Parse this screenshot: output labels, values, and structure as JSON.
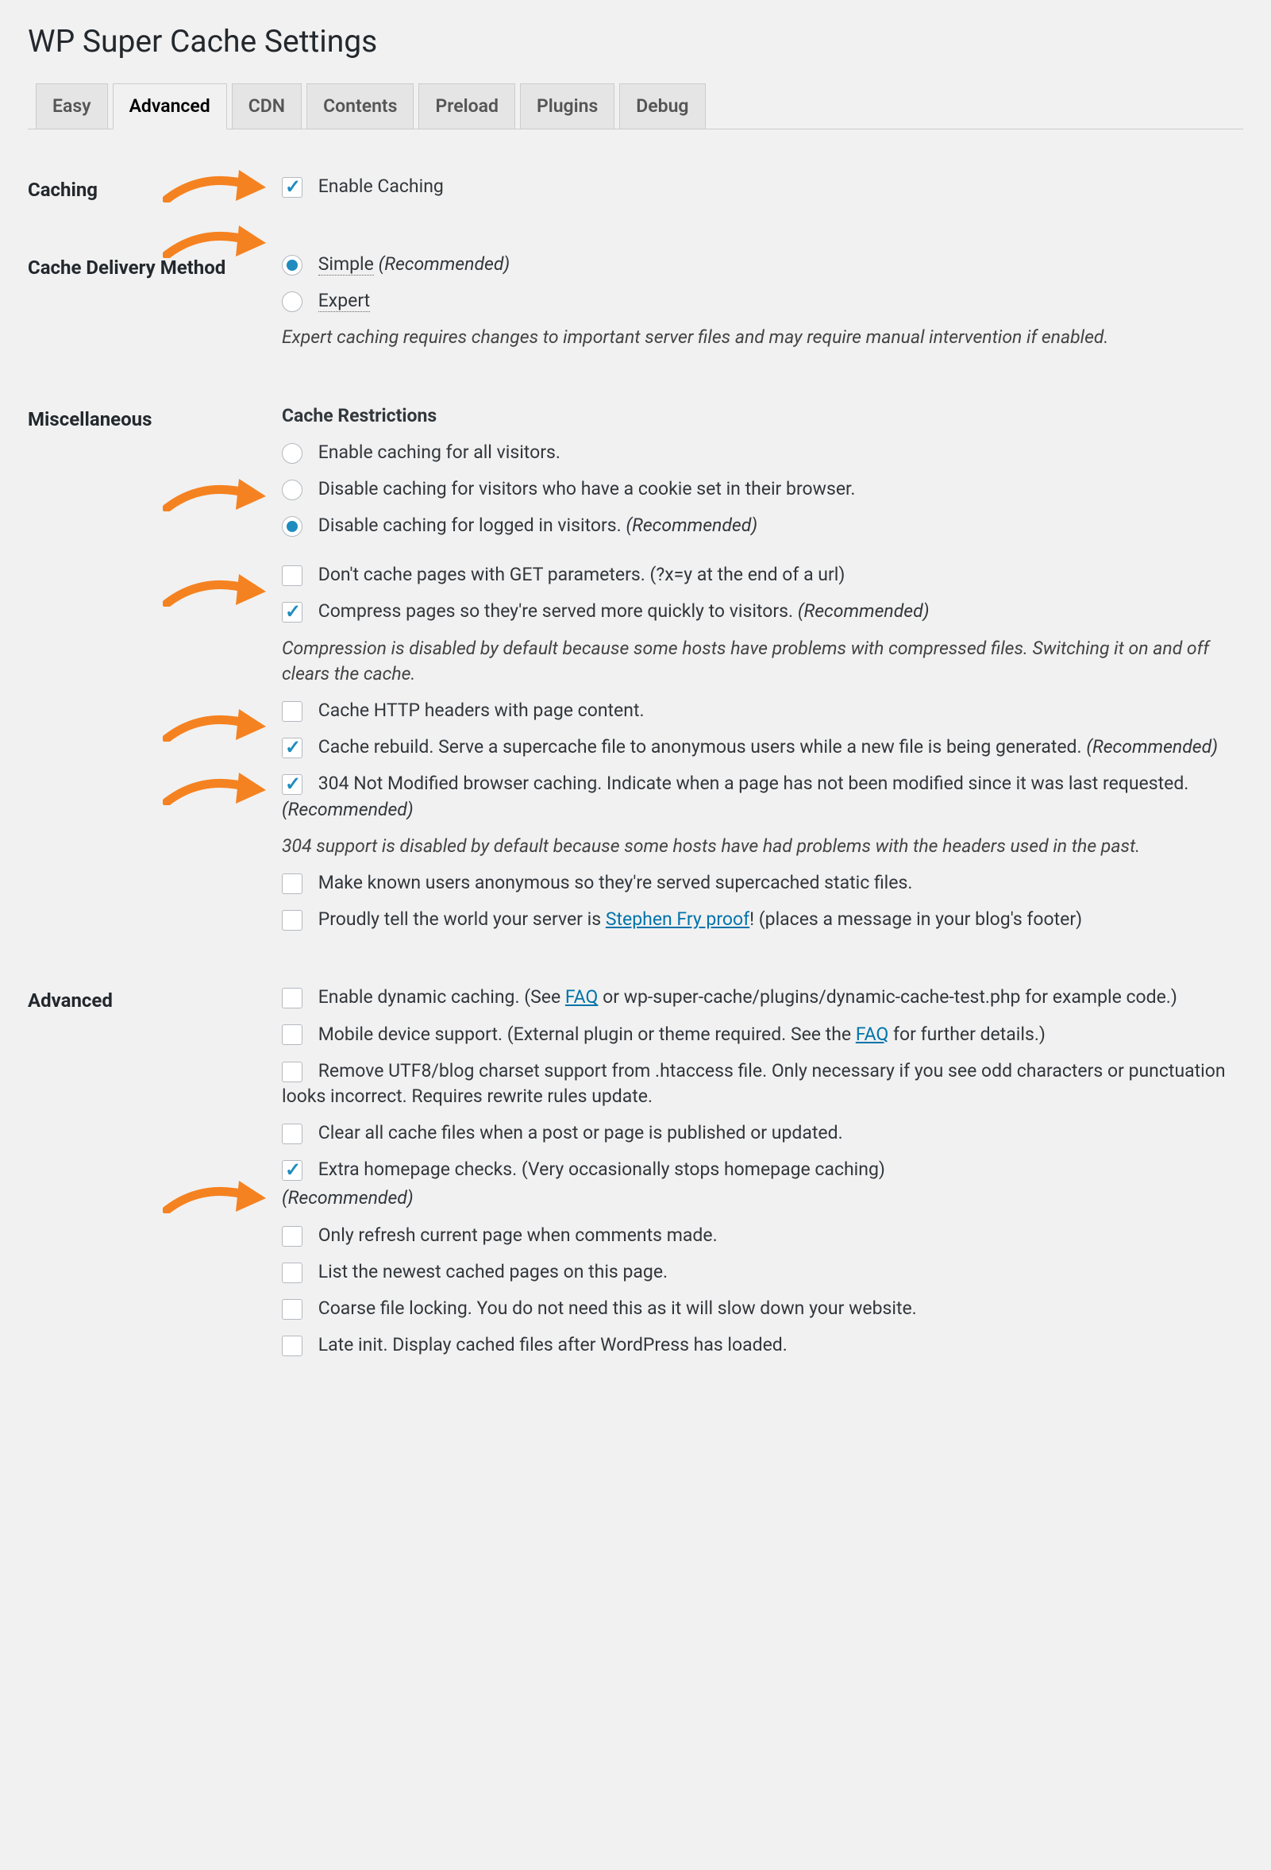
{
  "page_title": "WP Super Cache Settings",
  "tabs": [
    "Easy",
    "Advanced",
    "CDN",
    "Contents",
    "Preload",
    "Plugins",
    "Debug"
  ],
  "active_tab": 1,
  "recommended": "(Recommended)",
  "sections": {
    "caching": {
      "heading": "Caching",
      "enable_label": "Enable Caching"
    },
    "delivery": {
      "heading": "Cache Delivery Method",
      "simple": "Simple",
      "expert": "Expert",
      "expert_note": "Expert caching requires changes to important server files and may require manual intervention if enabled."
    },
    "misc": {
      "heading": "Miscellaneous",
      "restrictions_head": "Cache Restrictions",
      "r_all": "Enable caching for all visitors.",
      "r_cookie": "Disable caching for visitors who have a cookie set in their browser.",
      "r_logged": "Disable caching for logged in visitors.",
      "no_get": "Don't cache pages with GET parameters. (?x=y at the end of a url)",
      "compress": "Compress pages so they're served more quickly to visitors.",
      "compress_note": "Compression is disabled by default because some hosts have problems with compressed files. Switching it on and off clears the cache.",
      "http_headers": "Cache HTTP headers with page content.",
      "rebuild": "Cache rebuild. Serve a supercache file to anonymous users while a new file is being generated.",
      "not_modified": "304 Not Modified browser caching. Indicate when a page has not been modified since it was last requested.",
      "not_modified_note": "304 support is disabled by default because some hosts have had problems with the headers used in the past.",
      "anon": "Make known users anonymous so they're served supercached static files.",
      "proud_pre": "Proudly tell the world your server is ",
      "proud_link": "Stephen Fry proof",
      "proud_post": "! (places a message in your blog's footer)"
    },
    "advanced": {
      "heading": "Advanced",
      "dynamic_pre": "Enable dynamic caching. (See ",
      "faq": "FAQ",
      "dynamic_post": " or wp-super-cache/plugins/dynamic-cache-test.php for example code.)",
      "mobile_pre": "Mobile device support. (External plugin or theme required. See the ",
      "mobile_post": " for further details.)",
      "utf8": "Remove UTF8/blog charset support from .htaccess file. Only necessary if you see odd characters or punctuation looks incorrect. Requires rewrite rules update.",
      "clear_on_publish": "Clear all cache files when a post or page is published or updated.",
      "extra_home": "Extra homepage checks. (Very occasionally stops homepage caching)",
      "refresh_comments": "Only refresh current page when comments made.",
      "list_pages": "List the newest cached pages on this page.",
      "coarse_lock": "Coarse file locking. You do not need this as it will slow down your website.",
      "late_init": "Late init. Display cached files after WordPress has loaded."
    }
  }
}
